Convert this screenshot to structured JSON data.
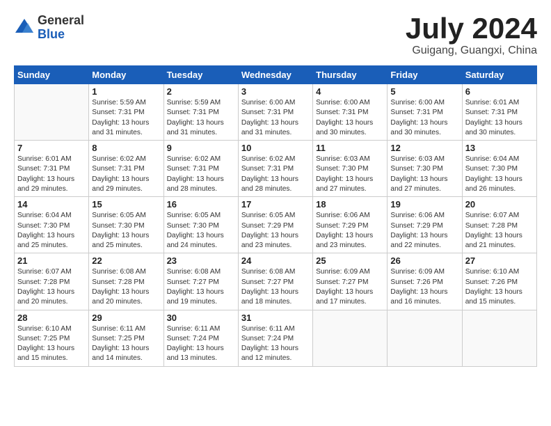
{
  "header": {
    "logo_general": "General",
    "logo_blue": "Blue",
    "title": "July 2024",
    "subtitle": "Guigang, Guangxi, China"
  },
  "columns": [
    "Sunday",
    "Monday",
    "Tuesday",
    "Wednesday",
    "Thursday",
    "Friday",
    "Saturday"
  ],
  "weeks": [
    [
      {
        "day": "",
        "info": ""
      },
      {
        "day": "1",
        "info": "Sunrise: 5:59 AM\nSunset: 7:31 PM\nDaylight: 13 hours\nand 31 minutes."
      },
      {
        "day": "2",
        "info": "Sunrise: 5:59 AM\nSunset: 7:31 PM\nDaylight: 13 hours\nand 31 minutes."
      },
      {
        "day": "3",
        "info": "Sunrise: 6:00 AM\nSunset: 7:31 PM\nDaylight: 13 hours\nand 31 minutes."
      },
      {
        "day": "4",
        "info": "Sunrise: 6:00 AM\nSunset: 7:31 PM\nDaylight: 13 hours\nand 30 minutes."
      },
      {
        "day": "5",
        "info": "Sunrise: 6:00 AM\nSunset: 7:31 PM\nDaylight: 13 hours\nand 30 minutes."
      },
      {
        "day": "6",
        "info": "Sunrise: 6:01 AM\nSunset: 7:31 PM\nDaylight: 13 hours\nand 30 minutes."
      }
    ],
    [
      {
        "day": "7",
        "info": "Sunrise: 6:01 AM\nSunset: 7:31 PM\nDaylight: 13 hours\nand 29 minutes."
      },
      {
        "day": "8",
        "info": "Sunrise: 6:02 AM\nSunset: 7:31 PM\nDaylight: 13 hours\nand 29 minutes."
      },
      {
        "day": "9",
        "info": "Sunrise: 6:02 AM\nSunset: 7:31 PM\nDaylight: 13 hours\nand 28 minutes."
      },
      {
        "day": "10",
        "info": "Sunrise: 6:02 AM\nSunset: 7:31 PM\nDaylight: 13 hours\nand 28 minutes."
      },
      {
        "day": "11",
        "info": "Sunrise: 6:03 AM\nSunset: 7:30 PM\nDaylight: 13 hours\nand 27 minutes."
      },
      {
        "day": "12",
        "info": "Sunrise: 6:03 AM\nSunset: 7:30 PM\nDaylight: 13 hours\nand 27 minutes."
      },
      {
        "day": "13",
        "info": "Sunrise: 6:04 AM\nSunset: 7:30 PM\nDaylight: 13 hours\nand 26 minutes."
      }
    ],
    [
      {
        "day": "14",
        "info": "Sunrise: 6:04 AM\nSunset: 7:30 PM\nDaylight: 13 hours\nand 25 minutes."
      },
      {
        "day": "15",
        "info": "Sunrise: 6:05 AM\nSunset: 7:30 PM\nDaylight: 13 hours\nand 25 minutes."
      },
      {
        "day": "16",
        "info": "Sunrise: 6:05 AM\nSunset: 7:30 PM\nDaylight: 13 hours\nand 24 minutes."
      },
      {
        "day": "17",
        "info": "Sunrise: 6:05 AM\nSunset: 7:29 PM\nDaylight: 13 hours\nand 23 minutes."
      },
      {
        "day": "18",
        "info": "Sunrise: 6:06 AM\nSunset: 7:29 PM\nDaylight: 13 hours\nand 23 minutes."
      },
      {
        "day": "19",
        "info": "Sunrise: 6:06 AM\nSunset: 7:29 PM\nDaylight: 13 hours\nand 22 minutes."
      },
      {
        "day": "20",
        "info": "Sunrise: 6:07 AM\nSunset: 7:28 PM\nDaylight: 13 hours\nand 21 minutes."
      }
    ],
    [
      {
        "day": "21",
        "info": "Sunrise: 6:07 AM\nSunset: 7:28 PM\nDaylight: 13 hours\nand 20 minutes."
      },
      {
        "day": "22",
        "info": "Sunrise: 6:08 AM\nSunset: 7:28 PM\nDaylight: 13 hours\nand 20 minutes."
      },
      {
        "day": "23",
        "info": "Sunrise: 6:08 AM\nSunset: 7:27 PM\nDaylight: 13 hours\nand 19 minutes."
      },
      {
        "day": "24",
        "info": "Sunrise: 6:08 AM\nSunset: 7:27 PM\nDaylight: 13 hours\nand 18 minutes."
      },
      {
        "day": "25",
        "info": "Sunrise: 6:09 AM\nSunset: 7:27 PM\nDaylight: 13 hours\nand 17 minutes."
      },
      {
        "day": "26",
        "info": "Sunrise: 6:09 AM\nSunset: 7:26 PM\nDaylight: 13 hours\nand 16 minutes."
      },
      {
        "day": "27",
        "info": "Sunrise: 6:10 AM\nSunset: 7:26 PM\nDaylight: 13 hours\nand 15 minutes."
      }
    ],
    [
      {
        "day": "28",
        "info": "Sunrise: 6:10 AM\nSunset: 7:25 PM\nDaylight: 13 hours\nand 15 minutes."
      },
      {
        "day": "29",
        "info": "Sunrise: 6:11 AM\nSunset: 7:25 PM\nDaylight: 13 hours\nand 14 minutes."
      },
      {
        "day": "30",
        "info": "Sunrise: 6:11 AM\nSunset: 7:24 PM\nDaylight: 13 hours\nand 13 minutes."
      },
      {
        "day": "31",
        "info": "Sunrise: 6:11 AM\nSunset: 7:24 PM\nDaylight: 13 hours\nand 12 minutes."
      },
      {
        "day": "",
        "info": ""
      },
      {
        "day": "",
        "info": ""
      },
      {
        "day": "",
        "info": ""
      }
    ]
  ]
}
